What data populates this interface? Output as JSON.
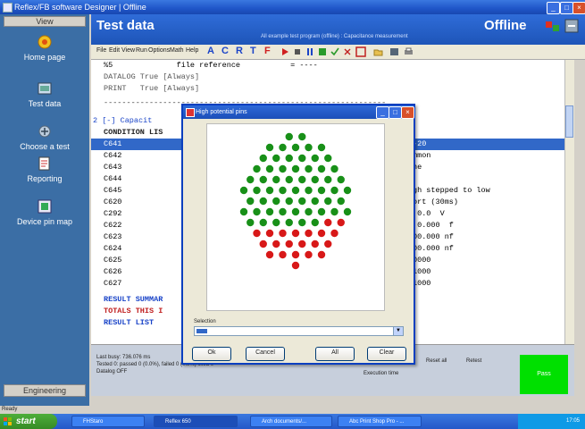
{
  "window": {
    "title": "Reflex/FB software Designer | Offline"
  },
  "nav": {
    "header": "View",
    "items": [
      {
        "label": "Home page",
        "icon": "home-icon"
      },
      {
        "label": "Test data",
        "icon": "test-data-icon"
      },
      {
        "label": "Choose a test",
        "icon": "choose-test-icon"
      },
      {
        "label": "Reporting",
        "icon": "report-icon"
      },
      {
        "label": "Device pin map",
        "icon": "pin-map-icon"
      }
    ],
    "footer": "Engineering"
  },
  "header": {
    "title": "Test data",
    "status_line": "All example test program (offline) : Capacitance measurement",
    "mode": "Offline"
  },
  "toolbar": {
    "menus": [
      "File",
      "Edit",
      "View",
      "Run",
      "Options",
      "Math",
      "Help"
    ],
    "letters": [
      "A",
      "C",
      "R",
      "T",
      "F"
    ]
  },
  "content": {
    "lines": [
      "%5              file reference           = ----",
      "DATALOG True [Always]",
      "PRINT   True [Always]",
      "--------------------------------------------------------------",
      "2 [-] Capacit",
      "CONDITION LIS",
      "C641",
      "C642",
      "C643",
      "C644",
      "C645",
      "C620",
      "C292",
      "C622",
      "C623",
      "C624",
      "C625",
      "C626",
      "C627",
      "RESULT SUMMAR",
      "TOTALS THIS I",
      "RESULT LIST"
    ],
    "right_values": [
      "-20",
      "mmon",
      "ne",
      "",
      "gh stepped to low",
      "ort (30ms)",
      " 0.0  V",
      " 0.000  f",
      "00.000 nf",
      "00.000 nf",
      "0000",
      "1000",
      "1000"
    ]
  },
  "bottom": {
    "info_lines": [
      "Last busy: 736.076 ms",
      "Tested 0: passed 0 (0.0%), failed 0 (0.0%) fixed 0",
      "Datalog OFF"
    ],
    "mid_labels": [
      "Execution time"
    ],
    "result_labels": [
      "Reset all",
      "Retest"
    ],
    "pass_label": "Pass"
  },
  "statusbar": {
    "text": "Ready"
  },
  "taskbar": {
    "start": "start",
    "tasks": [
      "FHStaro",
      "Reflex 650",
      "Arch documents/...",
      "Abc Print Shop Pro - ..."
    ],
    "clock": "17:05"
  },
  "dialog": {
    "title": "High potential pins",
    "selection_label": "Selection",
    "buttons": [
      "Ok",
      "Cancel",
      "All",
      "Clear"
    ],
    "pins": {
      "green_count": 60,
      "red_count": 21,
      "colors": {
        "green": "#189018",
        "red": "#d81818"
      }
    }
  },
  "colors": {
    "accent": "#1f55c8",
    "selection": "#3168c8",
    "pass": "#00e000",
    "nav": "#3b6ea5"
  }
}
